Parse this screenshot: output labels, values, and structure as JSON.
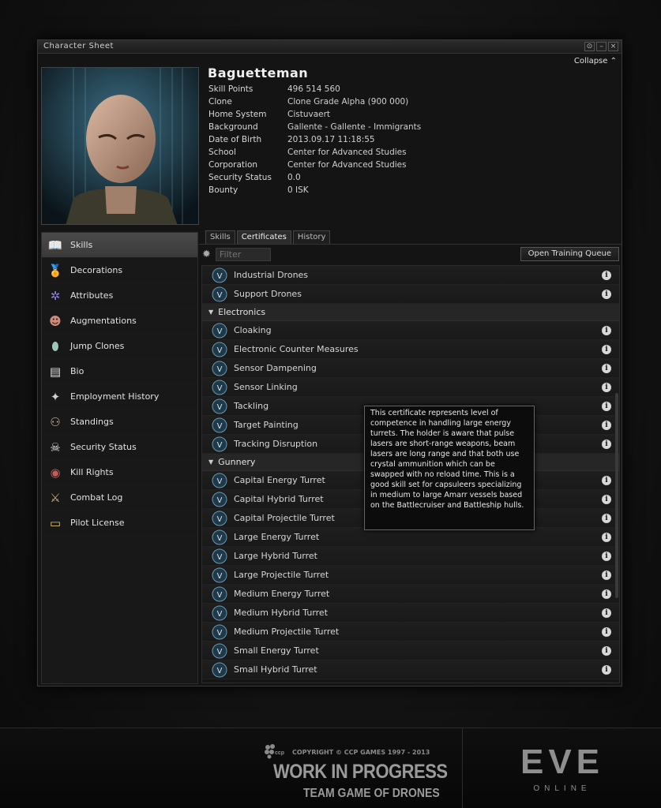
{
  "window": {
    "title": "Character Sheet",
    "collapse_label": "Collapse",
    "buttons": [
      "⊙",
      "–",
      "×"
    ]
  },
  "character": {
    "name": "Baguetteman",
    "fields": [
      {
        "label": "Skill Points",
        "value": "496 514 560"
      },
      {
        "label": "Clone",
        "value": "Clone Grade Alpha (900 000)"
      },
      {
        "label": "Home System",
        "value": "Cistuvaert"
      },
      {
        "label": "Background",
        "value": "Gallente - Gallente - Immigrants"
      },
      {
        "label": "Date of Birth",
        "value": "2013.09.17  11:18:55"
      },
      {
        "label": "School",
        "value": "Center for Advanced Studies"
      },
      {
        "label": "Corporation",
        "value": "Center for Advanced Studies"
      },
      {
        "label": "Security Status",
        "value": "0.0"
      },
      {
        "label": "Bounty",
        "value": "0 ISK"
      }
    ]
  },
  "sidebar": {
    "items": [
      {
        "label": "Skills",
        "icon": "book-icon"
      },
      {
        "label": "Decorations",
        "icon": "medal-icon"
      },
      {
        "label": "Attributes",
        "icon": "dna-icon"
      },
      {
        "label": "Augmentations",
        "icon": "implant-head-icon"
      },
      {
        "label": "Jump Clones",
        "icon": "clone-pod-icon"
      },
      {
        "label": "Bio",
        "icon": "document-icon"
      },
      {
        "label": "Employment History",
        "icon": "stars-icon"
      },
      {
        "label": "Standings",
        "icon": "people-icon"
      },
      {
        "label": "Security Status",
        "icon": "skull-icon"
      },
      {
        "label": "Kill Rights",
        "icon": "target-icon"
      },
      {
        "label": "Combat Log",
        "icon": "swords-icon"
      },
      {
        "label": "Pilot License",
        "icon": "license-card-icon"
      }
    ]
  },
  "tabs": [
    {
      "label": "Skills"
    },
    {
      "label": "Certificates"
    },
    {
      "label": "History"
    }
  ],
  "toolbar": {
    "filter_placeholder": "Filter",
    "open_queue_label": "Open Training Queue"
  },
  "certificates": {
    "drones_tail": [
      "Industrial Drones",
      "Support Drones"
    ],
    "electronics_label": "Electronics",
    "electronics": [
      "Cloaking",
      "Electronic Counter Measures",
      "Sensor Dampening",
      "Sensor Linking",
      "Tackling",
      "Target Painting",
      "Tracking Disruption"
    ],
    "gunnery_label": "Gunnery",
    "gunnery": [
      "Capital Energy Turret",
      "Capital Hybrid Turret",
      "Capital Projectile Turret",
      "Large Energy Turret",
      "Large Hybrid Turret",
      "Large Projectile Turret",
      "Medium Energy Turret",
      "Medium Hybrid Turret",
      "Medium Projectile Turret",
      "Small Energy Turret",
      "Small Hybrid Turret"
    ]
  },
  "tooltip": {
    "text": "This certificate represents level of competence in handling large energy turrets. The holder is aware that pulse lasers are short-range weapons, beam lasers are long range and that both use crystal ammunition which can be swapped with no reload time. This is a good skill set for capsuleers specializing in medium to large Amarr vessels based on the Battlecruiser and Battleship hulls."
  },
  "footer": {
    "copyright": "COPYRIGHT © CCP GAMES 1997 - 2013",
    "wip": "WORK IN PROGRESS",
    "team": "TEAM GAME OF DRONES",
    "eve_word": "EVE",
    "online_word": "ONLINE",
    "ccp_word": "ccp"
  }
}
